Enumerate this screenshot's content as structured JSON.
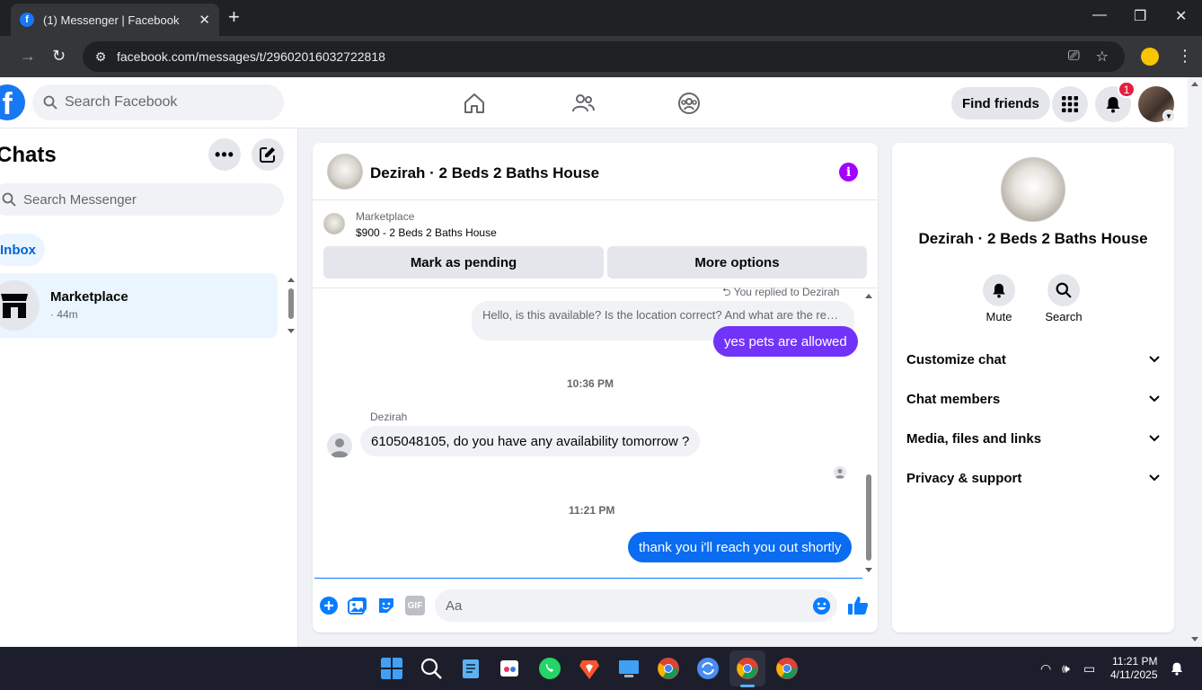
{
  "browser": {
    "tab_title": "(1) Messenger | Facebook",
    "url": "facebook.com/messages/t/29602016032722818"
  },
  "header": {
    "search_placeholder": "Search Facebook",
    "find_friends": "Find friends",
    "notification_count": "1"
  },
  "chats": {
    "title": "Chats",
    "search_placeholder": "Search Messenger",
    "filter": "Inbox",
    "items": [
      {
        "name": "Marketplace",
        "time": "· 44m"
      }
    ]
  },
  "conversation": {
    "title": "Dezirah · 2 Beds 2 Baths House",
    "marketplace_label": "Marketplace",
    "listing": "$900 - 2 Beds 2 Baths House",
    "mark_pending": "Mark as pending",
    "more_options": "More options",
    "replied_to": "You replied to Dezirah",
    "quoted_text": "Hello, is this available? Is the location correct? And what are the requirements?",
    "messages": [
      {
        "from": "me",
        "text": "yes pets are allowed"
      },
      {
        "type": "time",
        "text": "10:36 PM"
      },
      {
        "from": "Dezirah",
        "sender": "Dezirah",
        "text": "6105048105, do you have any availability tomorrow ?"
      },
      {
        "type": "time",
        "text": "11:21 PM"
      },
      {
        "from": "me",
        "text": "thank you i'll reach you out shortly"
      }
    ],
    "input_placeholder": "Aa",
    "gif_label": "GIF"
  },
  "details": {
    "title": "Dezirah · 2 Beds 2 Baths House",
    "mute": "Mute",
    "search": "Search",
    "sections": [
      "Customize chat",
      "Chat members",
      "Media, files and links",
      "Privacy & support"
    ]
  },
  "taskbar": {
    "time": "11:21 PM",
    "date": "4/11/2025"
  },
  "colors": {
    "brand": "#1877f2",
    "bubble_purple": "#7133f7",
    "bubble_blue": "#0a6cf1",
    "info_purple": "#a200ff"
  }
}
